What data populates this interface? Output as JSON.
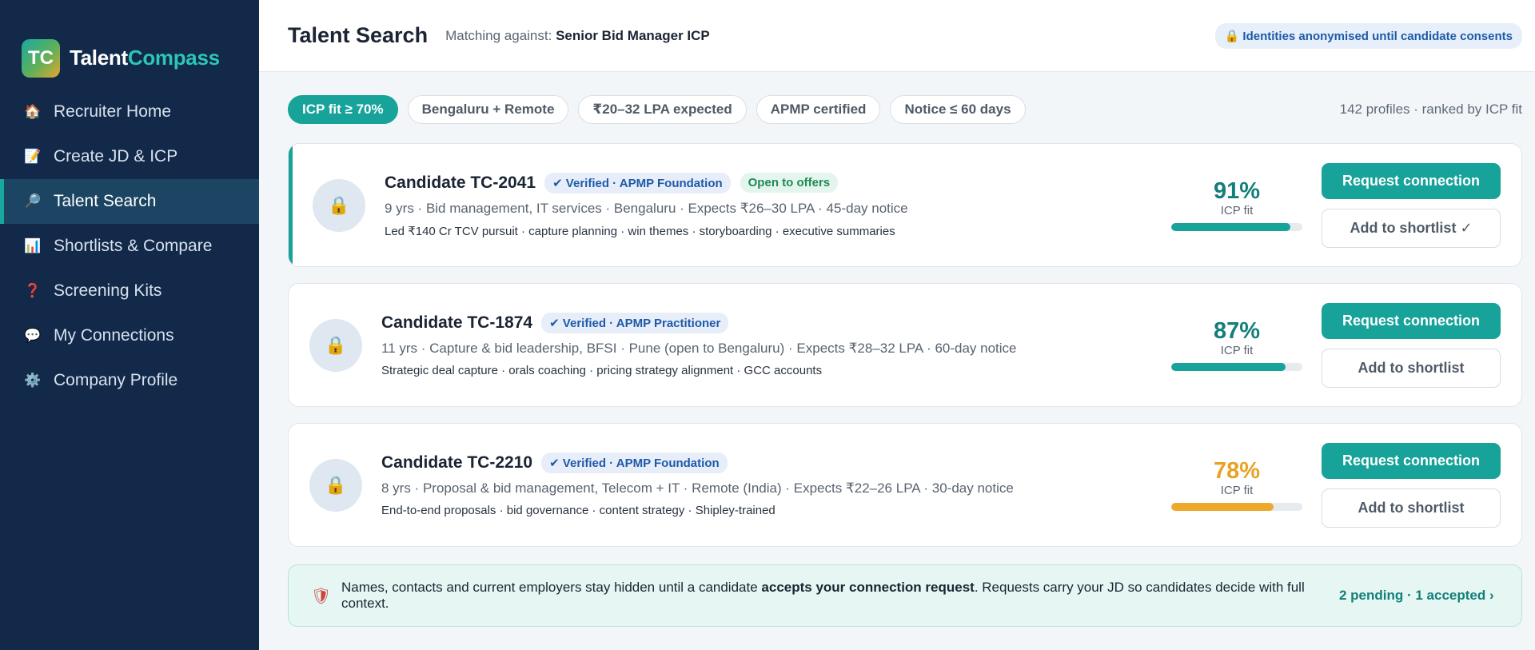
{
  "brand": {
    "logo_text": "TC",
    "name_part1": "Talent",
    "name_part2": "Compass"
  },
  "sidebar": {
    "items": [
      {
        "label": "Recruiter Home",
        "icon": "house-icon",
        "glyph": "🏠"
      },
      {
        "label": "Create JD & ICP",
        "icon": "memo-icon",
        "glyph": "📝"
      },
      {
        "label": "Talent Search",
        "icon": "magnifier-icon",
        "glyph": "🔎",
        "active": true
      },
      {
        "label": "Shortlists & Compare",
        "icon": "bar-chart-icon",
        "glyph": "📊"
      },
      {
        "label": "Screening Kits",
        "icon": "question-icon",
        "glyph": "❓"
      },
      {
        "label": "My Connections",
        "icon": "speech-bubble-icon",
        "glyph": "💬"
      },
      {
        "label": "Company Profile",
        "icon": "gear-icon",
        "glyph": "⚙️"
      }
    ]
  },
  "header": {
    "title": "Talent Search",
    "matching_prefix": "Matching against:",
    "matching_value": "Senior Bid Manager ICP",
    "privacy_note": "🔒 Identities anonymised until candidate consents"
  },
  "filters": {
    "chips": [
      "ICP fit ≥ 70%",
      "Bengaluru + Remote",
      "₹20–32 LPA expected",
      "APMP certified",
      "Notice ≤ 60 days"
    ],
    "result_count": "142 profiles · ranked by ICP fit"
  },
  "candidates": [
    {
      "name": "Candidate TC-2041",
      "badge": "✔ Verified · APMP Foundation",
      "status": "Open to offers",
      "meta": "9 yrs · Bid management, IT services · Bengaluru · Expects ₹26–30 LPA · 45-day notice",
      "skills": "Led ₹140 Cr TCV pursuit · capture planning · win themes · storyboarding · executive summaries",
      "fit_pct": "91%",
      "fit_value": 91,
      "fit_label": "ICP fit",
      "primary_action": "Request connection",
      "secondary_action": "Add to shortlist ✓"
    },
    {
      "name": "Candidate TC-1874",
      "badge": "✔ Verified · APMP Practitioner",
      "status": "",
      "meta": "11 yrs · Capture & bid leadership, BFSI · Pune (open to Bengaluru) · Expects ₹28–32 LPA · 60-day notice",
      "skills": "Strategic deal capture · orals coaching · pricing strategy alignment · GCC accounts",
      "fit_pct": "87%",
      "fit_value": 87,
      "fit_label": "ICP fit",
      "primary_action": "Request connection",
      "secondary_action": "Add to shortlist"
    },
    {
      "name": "Candidate TC-2210",
      "badge": "✔ Verified · APMP Foundation",
      "status": "",
      "meta": "8 yrs · Proposal & bid management, Telecom + IT · Remote (India) · Expects ₹22–26 LPA · 30-day notice",
      "skills": "End-to-end proposals · bid governance · content strategy · Shipley-trained",
      "fit_pct": "78%",
      "fit_value": 78,
      "fit_label": "ICP fit",
      "primary_action": "Request connection",
      "secondary_action": "Add to shortlist"
    }
  ],
  "notice": {
    "text_before": "Names, contacts and current employers stay hidden until a candidate ",
    "text_bold": "accepts your connection request",
    "text_after": ". Requests carry your JD so candidates decide with full context.",
    "link": "2 pending · 1 accepted ›"
  },
  "colors": {
    "accent": "#17a39a",
    "sidebar": "#12294a",
    "amber": "#f0a82c"
  }
}
